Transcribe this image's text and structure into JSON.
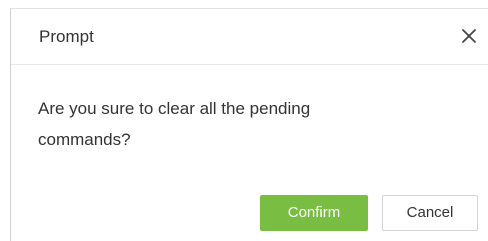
{
  "dialog": {
    "title": "Prompt",
    "message_line1": "Are you sure to clear all the pending",
    "message_line2": "commands?",
    "confirm_label": "Confirm",
    "cancel_label": "Cancel",
    "close_icon": "close-icon"
  },
  "colors": {
    "confirm_bg": "#79be42",
    "text": "#333333",
    "border": "#d4d4d4"
  }
}
